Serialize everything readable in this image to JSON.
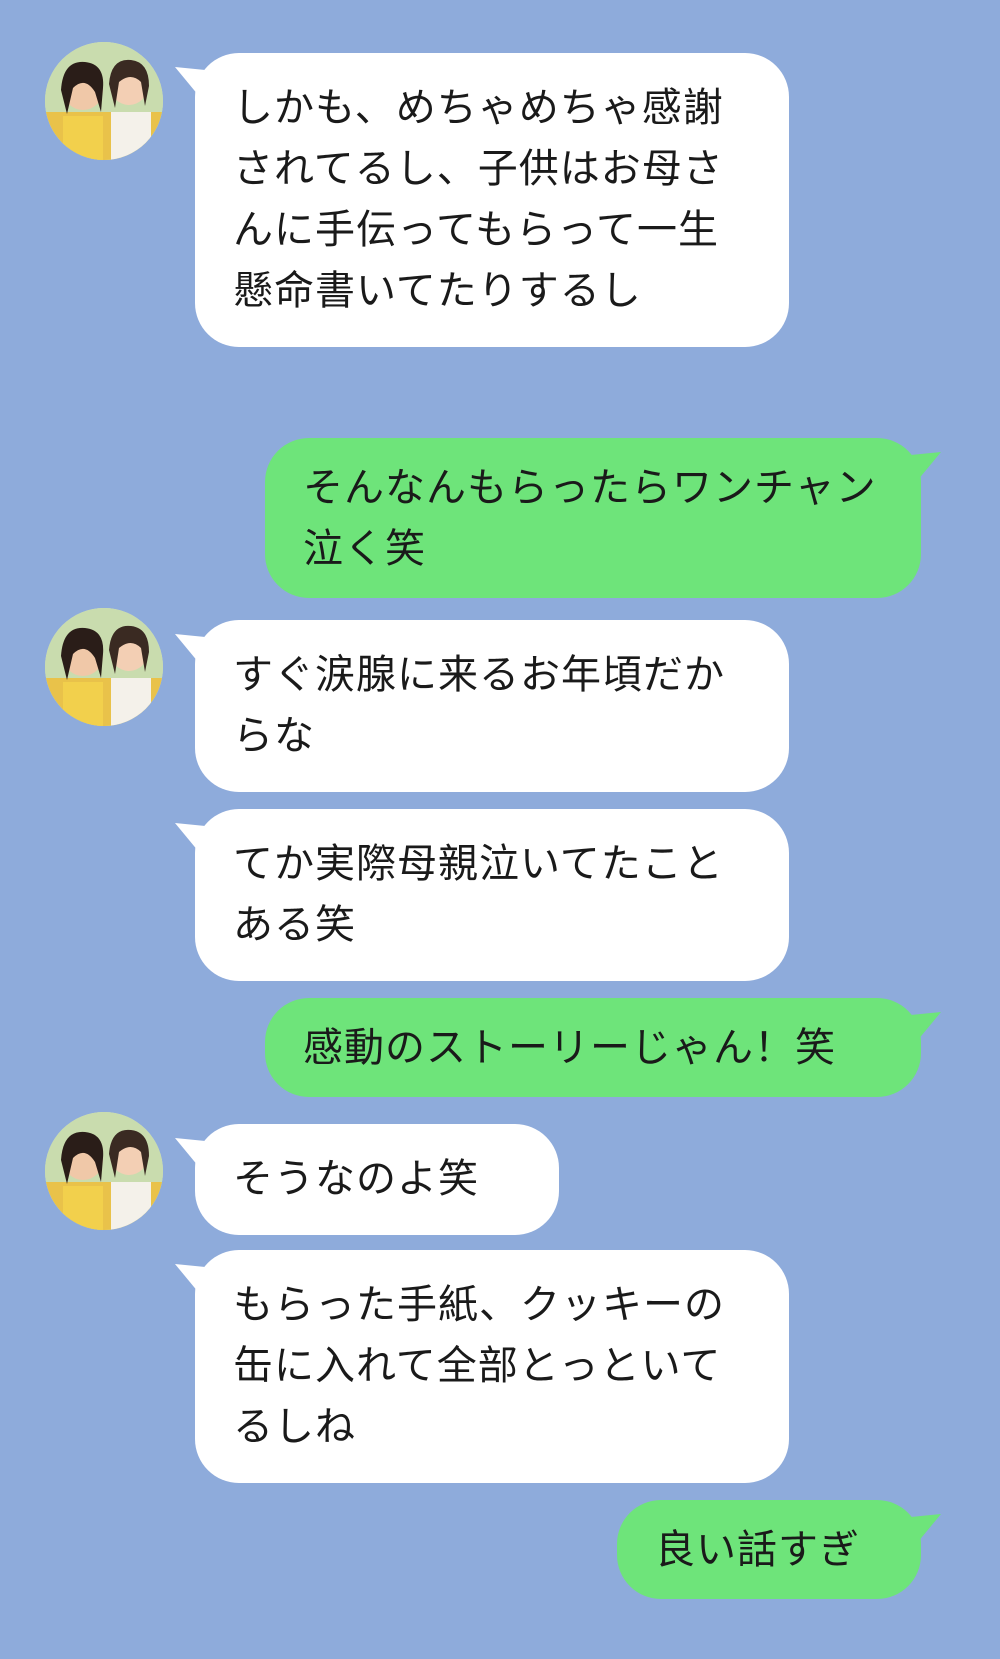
{
  "colors": {
    "background": "#8eabdb",
    "incoming_bubble": "#ffffff",
    "outgoing_bubble": "#6ee47a",
    "text": "#1a1a1a"
  },
  "contact": {
    "avatar_icon": "contact-photo-avatar"
  },
  "messages": [
    {
      "side": "incoming",
      "text": "しかも、めちゃめちゃ感謝されてるし、子供はお母さんに手伝ってもらって一生懸命書いてたりするし"
    },
    {
      "side": "outgoing",
      "text": "そんなんもらったらワンチャン泣く笑"
    },
    {
      "side": "incoming",
      "text": "すぐ涙腺に来るお年頃だからな"
    },
    {
      "side": "incoming",
      "text": "てか実際母親泣いてたことある笑"
    },
    {
      "side": "outgoing",
      "text": "感動のストーリーじゃん！笑"
    },
    {
      "side": "incoming",
      "text": "そうなのよ笑"
    },
    {
      "side": "incoming",
      "text": "もらった手紙、クッキーの缶に入れて全部とっといてるしね"
    },
    {
      "side": "outgoing",
      "text": "良い話すぎ"
    }
  ]
}
